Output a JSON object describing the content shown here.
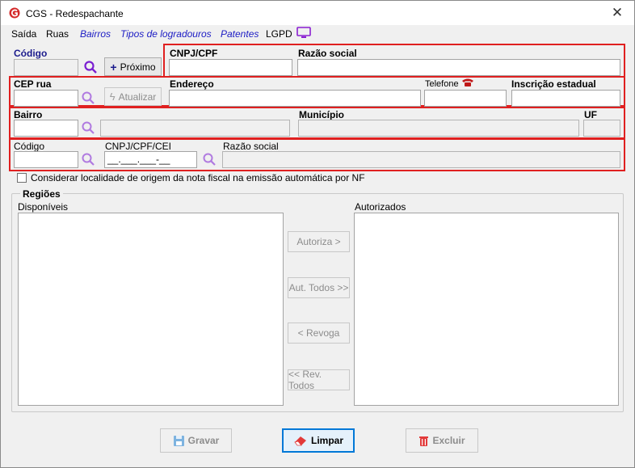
{
  "window": {
    "title": "CGS - Redespachante"
  },
  "menu": {
    "saida": "Saída",
    "ruas": "Ruas",
    "bairros": "Bairros",
    "tipos_logradouros": "Tipos de logradouros",
    "patentes": "Patentes",
    "lgpd": "LGPD"
  },
  "codigo": {
    "label": "Código",
    "value": "",
    "proximo": "Próximo"
  },
  "cnpj": {
    "label": "CNPJ/CPF",
    "value": ""
  },
  "razao_social": {
    "label": "Razão social",
    "value": ""
  },
  "cep": {
    "label": "CEP rua",
    "value": "",
    "atualizar": "Atualizar"
  },
  "endereco": {
    "label": "Endereço",
    "value": ""
  },
  "telefone": {
    "label": "Telefone",
    "value": ""
  },
  "inscricao": {
    "label": "Inscrição estadual",
    "value": ""
  },
  "bairro": {
    "label": "Bairro",
    "value": "",
    "name": ""
  },
  "municipio": {
    "label": "Município",
    "value": ""
  },
  "uf": {
    "label": "UF",
    "value": ""
  },
  "destino": {
    "codigo_label": "Código",
    "codigo_value": "",
    "cnpj_label": "CNPJ/CPF/CEI",
    "cnpj_value": "__.___.___-__",
    "razao_label": "Razão social",
    "razao_value": ""
  },
  "considerar": {
    "label": "Considerar localidade de origem da nota fiscal na emissão automática por NF",
    "checked": false
  },
  "regioes": {
    "title": "Regiões",
    "disponiveis": "Disponíveis",
    "autorizados": "Autorizados",
    "autoriza": "Autoriza >",
    "aut_todos": "Aut. Todos >>",
    "revoga": "< Revoga",
    "rev_todos": "<< Rev. Todos"
  },
  "actions": {
    "gravar": "Gravar",
    "limpar": "Limpar",
    "excluir": "Excluir"
  },
  "colors": {
    "highlight": "#e02020",
    "lens": "#7a1fd1",
    "link": "#1b1bc4"
  }
}
